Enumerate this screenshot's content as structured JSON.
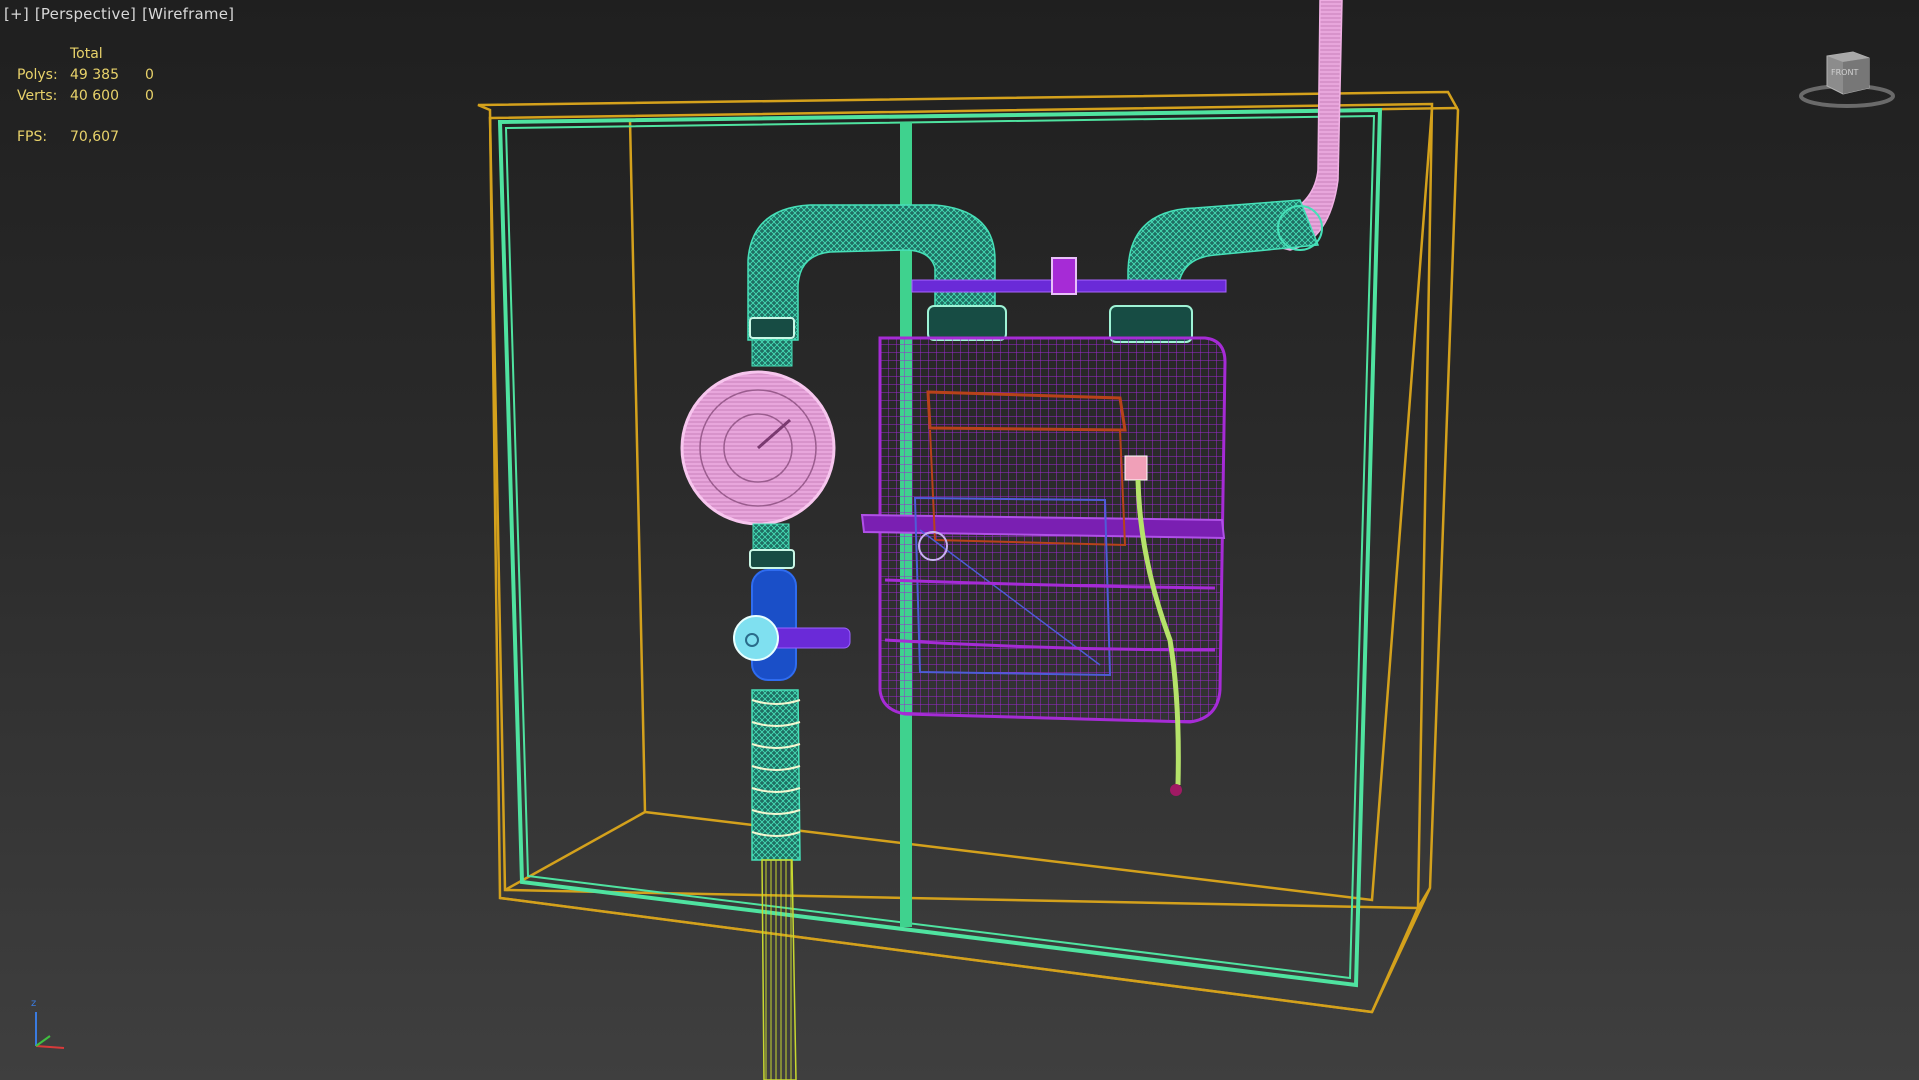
{
  "viewport": {
    "menu_plus": "[+]",
    "view_mode": "[Perspective]",
    "shading_mode": "[Wireframe]"
  },
  "stats": {
    "header": "Total",
    "polys_label": "Polys:",
    "polys_total": "49 385",
    "polys_selected": "0",
    "verts_label": "Verts:",
    "verts_total": "40 600",
    "verts_selected": "0",
    "fps_label": "FPS:",
    "fps_value": "70,607"
  },
  "viewcube": {
    "face_label": "FRONT"
  },
  "axis_gizmo": {
    "z_label": "z"
  },
  "colors": {
    "cabinet_outer": "#d4a11c",
    "cabinet_frame": "#4fe3a0",
    "pipes": "#38c9a6",
    "gauge": "#f0a8e0",
    "meter_body": "#a62bd6",
    "valve": "#1a4fc8",
    "hose": "#c8d830"
  },
  "scene": {
    "objects": [
      "gas-cabinet",
      "cabinet-frame",
      "inlet-pipe",
      "outlet-pipe",
      "pressure-gauge",
      "ball-valve",
      "gas-meter",
      "vent-pipe",
      "signal-cable",
      "ground-pipe"
    ]
  }
}
